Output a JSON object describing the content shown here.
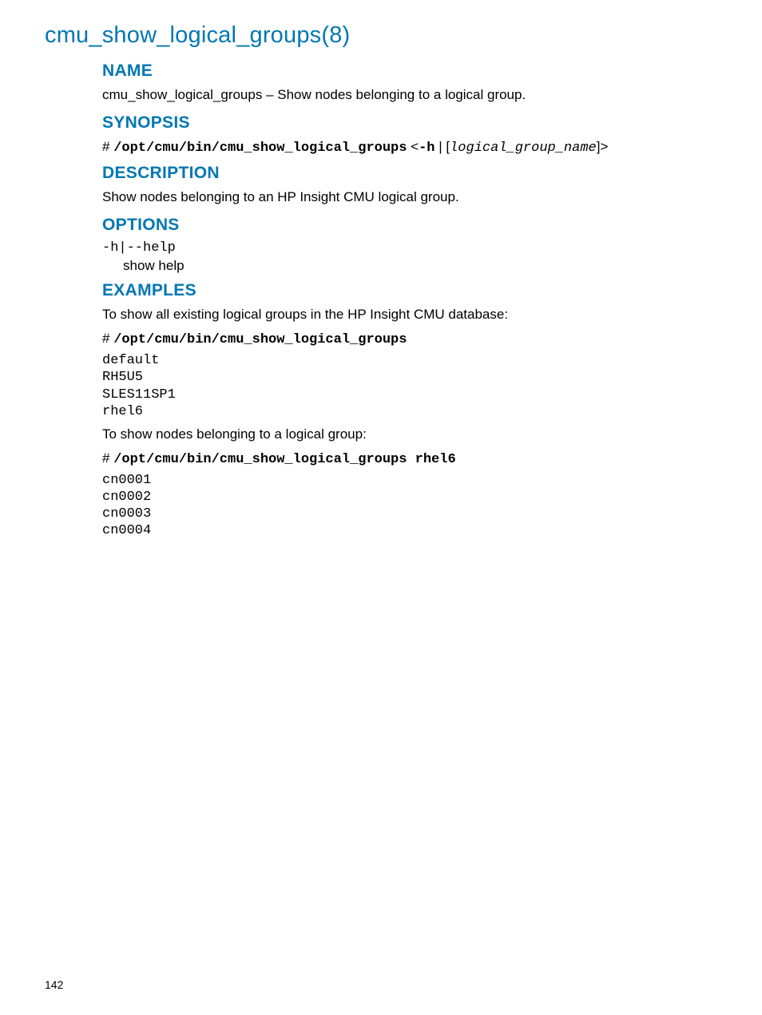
{
  "page_title": "cmu_show_logical_groups(8)",
  "sections": {
    "name": {
      "heading": "NAME",
      "text": "cmu_show_logical_groups – Show nodes belonging to a logical group."
    },
    "synopsis": {
      "heading": "SYNOPSIS",
      "prefix": "# ",
      "cmd": "/opt/cmu/bin/cmu_show_logical_groups",
      "opt_open": " <",
      "opt_flag": "-h",
      "opt_pipe": " | [",
      "opt_arg": "logical_group_name",
      "opt_close": "]>"
    },
    "description": {
      "heading": "DESCRIPTION",
      "text": "Show nodes belonging to an HP Insight CMU logical group."
    },
    "options": {
      "heading": "OPTIONS",
      "flag": "-h|--help",
      "desc": "show help"
    },
    "examples": {
      "heading": "EXAMPLES",
      "intro1": "To show all existing logical groups in the HP Insight CMU database:",
      "cmd1_prefix": "# ",
      "cmd1": "/opt/cmu/bin/cmu_show_logical_groups",
      "output1": "default\nRH5U5\nSLES11SP1\nrhel6",
      "intro2": "To show nodes belonging to a logical group:",
      "cmd2_prefix": "# ",
      "cmd2": "/opt/cmu/bin/cmu_show_logical_groups rhel6",
      "output2": "cn0001\ncn0002\ncn0003\ncn0004"
    }
  },
  "page_number": "142"
}
